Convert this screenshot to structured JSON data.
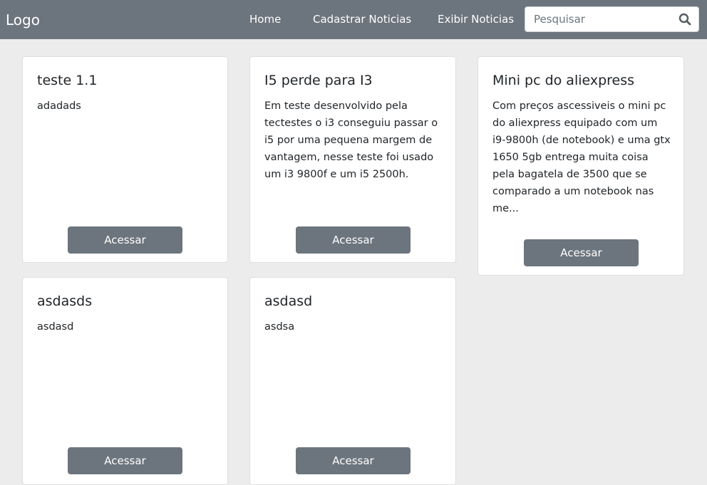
{
  "navbar": {
    "logo": "Logo",
    "links": [
      "Home",
      "Cadastrar Noticias",
      "Exibir Noticias"
    ],
    "search_placeholder": "Pesquisar"
  },
  "cards": [
    {
      "title": "teste 1.1",
      "text": "adadads",
      "button": "Acessar"
    },
    {
      "title": "I5 perde para I3",
      "text": "Em teste desenvolvido pela tectestes o i3 conseguiu passar o i5 por uma pequena margem de vantagem, nesse teste foi usado um i3 9800f e um i5 2500h.",
      "button": "Acessar"
    },
    {
      "title": "Mini pc do aliexpress",
      "text": "Com preços ascessiveis o mini pc do aliexpress equipado com um i9-9800h (de notebook) e uma gtx 1650 5gb entrega muita coisa pela bagatela de 3500 que se comparado a um notebook nas me...",
      "button": "Acessar"
    },
    {
      "title": "asdasds",
      "text": "asdasd",
      "button": "Acessar"
    },
    {
      "title": "asdasd",
      "text": "asdsa",
      "button": "Acessar"
    }
  ]
}
